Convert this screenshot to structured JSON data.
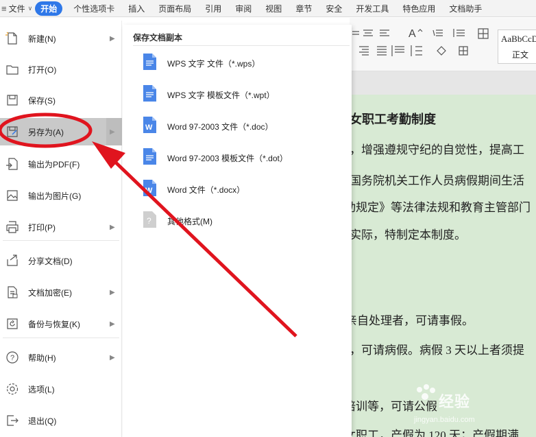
{
  "menubar": {
    "file_label": "文件",
    "start_label": "开始",
    "tabs": [
      "个性选项卡",
      "插入",
      "页面布局",
      "引用",
      "审阅",
      "视图",
      "章节",
      "安全",
      "开发工具",
      "特色应用",
      "文档助手"
    ]
  },
  "left_menu": {
    "items": [
      {
        "label": "新建(N)",
        "icon": "new-file-icon",
        "arrow": true
      },
      {
        "label": "打开(O)",
        "icon": "folder-icon",
        "arrow": false
      },
      {
        "label": "保存(S)",
        "icon": "save-icon",
        "arrow": false
      },
      {
        "label": "另存为(A)",
        "icon": "save-as-icon",
        "arrow": true,
        "active": true
      },
      {
        "label": "输出为PDF(F)",
        "icon": "pdf-export-icon",
        "arrow": false
      },
      {
        "label": "输出为图片(G)",
        "icon": "image-export-icon",
        "arrow": false
      },
      {
        "label": "打印(P)",
        "icon": "printer-icon",
        "arrow": true
      },
      {
        "label": "分享文档(D)",
        "icon": "share-icon",
        "arrow": false
      },
      {
        "label": "文档加密(E)",
        "icon": "encrypt-icon",
        "arrow": true
      },
      {
        "label": "备份与恢复(K)",
        "icon": "backup-icon",
        "arrow": true
      },
      {
        "label": "帮助(H)",
        "icon": "help-icon",
        "arrow": true
      },
      {
        "label": "选项(L)",
        "icon": "gear-icon",
        "arrow": false
      },
      {
        "label": "退出(Q)",
        "icon": "exit-icon",
        "arrow": false
      }
    ]
  },
  "submenu": {
    "title": "保存文档副本",
    "items": [
      {
        "label": "WPS 文字 文件（*.wps）",
        "icon": "wps-file-icon"
      },
      {
        "label": "WPS 文字 模板文件（*.wpt）",
        "icon": "wps-template-icon"
      },
      {
        "label": "Word 97-2003 文件（*.doc）",
        "icon": "word-doc-icon"
      },
      {
        "label": "Word 97-2003 模板文件（*.dot）",
        "icon": "word-template-icon"
      },
      {
        "label": "Word 文件（*.docx）",
        "icon": "word-docx-icon"
      },
      {
        "label": "其他格式(M)",
        "icon": "other-format-icon"
      }
    ]
  },
  "ribbon": {
    "style_sample": "AaBbCcDd",
    "style_name": "正文"
  },
  "document": {
    "lines": [
      "女职工考勤制度",
      "，增强遵规守纪的自觉性，提高工",
      "国务院机关工作人员病假期间生活",
      "动规定》等法律法规和教育主管部门",
      "实际，特制定本制度。",
      "亲自处理者，可请事假。",
      "，可请病假。病假 3 天以上者须提",
      "培训等，可请公假",
      "女职工，产假为 120 天；产假期满"
    ]
  },
  "watermark": {
    "text": "经验",
    "url": "jingyan.baidu.com"
  },
  "colors": {
    "accent": "#2f78e8",
    "annotation_red": "#e0141e",
    "page_green": "#d8ead4",
    "active_row": "#c9c9c9"
  }
}
